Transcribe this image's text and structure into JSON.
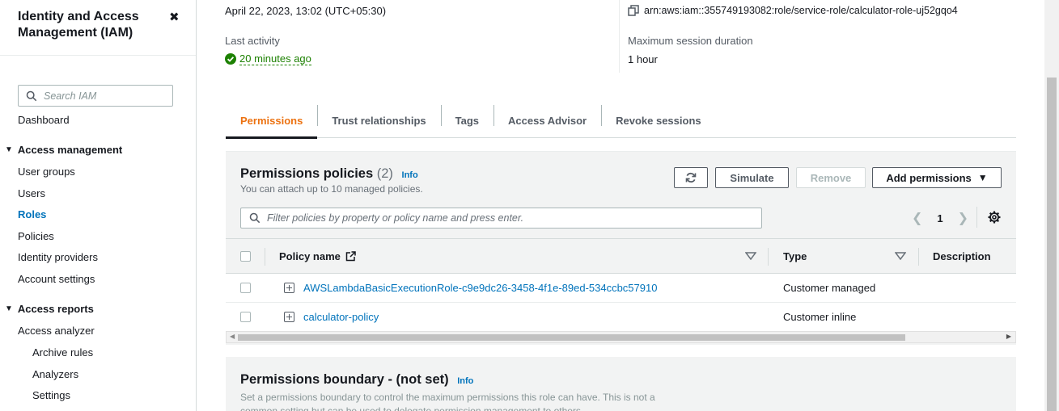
{
  "sidebar": {
    "title": "Identity and Access Management (IAM)",
    "search_placeholder": "Search IAM",
    "dashboard": "Dashboard",
    "access_management": {
      "label": "Access management",
      "items": [
        "User groups",
        "Users",
        "Roles",
        "Policies",
        "Identity providers",
        "Account settings"
      ],
      "active": "Roles"
    },
    "access_reports": {
      "label": "Access reports",
      "items": [
        "Access analyzer"
      ],
      "sub_items": [
        "Archive rules",
        "Analyzers",
        "Settings"
      ]
    }
  },
  "summary": {
    "created_date": "April 22, 2023, 13:02 (UTC+05:30)",
    "last_activity_label": "Last activity",
    "last_activity_value": "20 minutes ago",
    "arn": "arn:aws:iam::355749193082:role/service-role/calculator-role-uj52gqo4",
    "max_session_label": "Maximum session duration",
    "max_session_value": "1 hour"
  },
  "tabs": [
    "Permissions",
    "Trust relationships",
    "Tags",
    "Access Advisor",
    "Revoke sessions"
  ],
  "active_tab": "Permissions",
  "permissions_policies": {
    "title": "Permissions policies",
    "count": "(2)",
    "info": "Info",
    "description": "You can attach up to 10 managed policies.",
    "buttons": {
      "simulate": "Simulate",
      "remove": "Remove",
      "add_permissions": "Add permissions"
    },
    "filter_placeholder": "Filter policies by property or policy name and press enter.",
    "page": "1",
    "columns": {
      "policy_name": "Policy name",
      "type": "Type",
      "description": "Description"
    },
    "rows": [
      {
        "name": "AWSLambdaBasicExecutionRole-c9e9dc26-3458-4f1e-89ed-534ccbc57910",
        "type": "Customer managed"
      },
      {
        "name": "calculator-policy",
        "type": "Customer inline"
      }
    ]
  },
  "permissions_boundary": {
    "title": "Permissions boundary - (not set)",
    "info": "Info",
    "description": "Set a permissions boundary to control the maximum permissions this role can have. This is not a common setting but can be used to delegate permission management to others."
  },
  "colors": {
    "link": "#0073bb",
    "active_tab": "#ec7211",
    "success": "#1d8102",
    "panel_bg": "#f2f3f3"
  }
}
